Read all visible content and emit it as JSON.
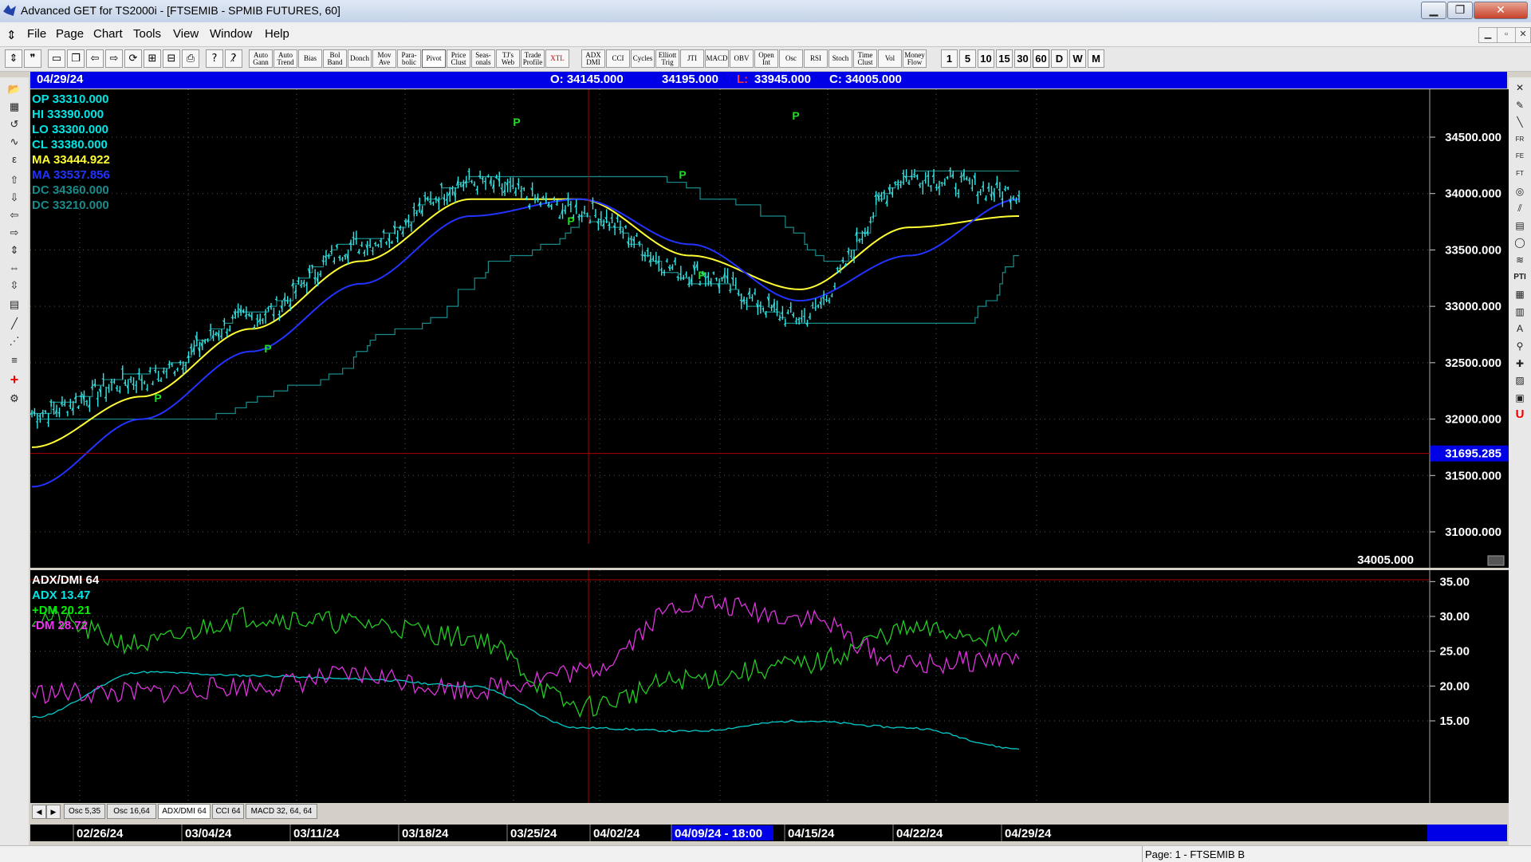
{
  "window": {
    "title": "Advanced GET for TS2000i - [FTSEMIB - SPMIB FUTURES, 60]",
    "buttons": {
      "minimize": "▁",
      "maximize": "❐",
      "close": "✕"
    }
  },
  "menu": {
    "items": [
      "File",
      "Page",
      "Chart",
      "Tools",
      "View",
      "Window",
      "Help"
    ],
    "mdi_buttons": [
      "▁",
      "▫",
      "✕"
    ]
  },
  "toolbar": {
    "icons": [
      "pin-icon",
      "quote-icon",
      "new-page-icon",
      "copy-page-icon",
      "back-icon",
      "forward-icon",
      "refresh-icon",
      "layout-icon",
      "grid-icon",
      "print-icon",
      "help-icon",
      "context-help-icon"
    ],
    "study_buttons": [
      "Auto\nGann",
      "Auto\nTrend",
      "Bias",
      "Bol\nBand",
      "Donch",
      "Mov\nAve",
      "Para-\nbolic",
      "Pivot",
      "Price\nClust",
      "Seas-\nonals",
      "TJ's\nWeb",
      "Trade\nProfile",
      "XTL",
      "ADX\nDMI",
      "CCI",
      "Cycles",
      "Elliott\nTrig",
      "JTI",
      "MACD",
      "OBV",
      "Open\nInt",
      "Osc",
      "RSI",
      "Stoch",
      "Time\nClust",
      "Vol",
      "Money\nFlow"
    ],
    "intervals": [
      "1",
      "5",
      "10",
      "15",
      "30",
      "60",
      "D",
      "W",
      "M"
    ],
    "active_interval": "60"
  },
  "header": {
    "date": "04/29/24",
    "open": "O: 34145.000",
    "high": "34195.000",
    "low_label": "L:",
    "low": "33945.000",
    "close": "C: 34005.000"
  },
  "price_legend": [
    {
      "label": "OP",
      "value": "33310.000",
      "color": "#00e5e5"
    },
    {
      "label": "HI",
      "value": "33390.000",
      "color": "#00e5e5"
    },
    {
      "label": "LO",
      "value": "33300.000",
      "color": "#00e5e5"
    },
    {
      "label": "CL",
      "value": "33380.000",
      "color": "#00e5e5"
    },
    {
      "label": "MA",
      "value": "33444.922",
      "color": "#ffff33"
    },
    {
      "label": "MA",
      "value": "33537.856",
      "color": "#2233ff"
    },
    {
      "label": "DC",
      "value": "34360.000",
      "color": "#1a8a8a"
    },
    {
      "label": "DC",
      "value": "33210.000",
      "color": "#1a8a8a"
    }
  ],
  "price_axis": {
    "ticks": [
      "34500.000",
      "34000.000",
      "33500.000",
      "33000.000",
      "32500.000",
      "32000.000",
      "31500.000",
      "31000.000"
    ],
    "cursor_value": "31695.285",
    "last_value": "34005.000"
  },
  "pivot_label": "P",
  "indicator": {
    "title": "ADX/DMI 64",
    "legend": [
      {
        "label": "ADX",
        "value": "13.47",
        "color": "#00e5e5"
      },
      {
        "label": "+DM",
        "value": "20.21",
        "color": "#00ee00"
      },
      {
        "label": "-DM",
        "value": "28.72",
        "color": "#ee33ee"
      }
    ],
    "ticks": [
      "35.00",
      "30.00",
      "25.00",
      "20.00",
      "15.00"
    ]
  },
  "tabs": [
    "Osc 5,35",
    "Osc 16,64",
    "ADX/DMI 64",
    "CCI 64",
    "MACD 32, 64, 64"
  ],
  "active_tab": "ADX/DMI 64",
  "dates": [
    "02/26/24",
    "03/04/24",
    "03/11/24",
    "03/18/24",
    "03/25/24",
    "04/02/24",
    "04/09/24 - 18:00",
    "04/15/24",
    "04/22/24",
    "04/29/24"
  ],
  "status": {
    "page": "Page: 1 - FTSEMIB B"
  },
  "chart_data": {
    "type": "line",
    "title": "FTSEMIB - SPMIB FUTURES, 60",
    "x": [
      "02/26/24",
      "03/04/24",
      "03/11/24",
      "03/18/24",
      "03/25/24",
      "04/02/24",
      "04/09/24",
      "04/15/24",
      "04/22/24",
      "04/29/24"
    ],
    "series": [
      {
        "name": "CL",
        "values": [
          32050,
          32350,
          32900,
          33550,
          34100,
          33850,
          33300,
          32900,
          34150,
          34005
        ]
      },
      {
        "name": "MA",
        "values": [
          31750,
          32200,
          32800,
          33400,
          33950,
          33950,
          33450,
          33150,
          33700,
          33800
        ]
      },
      {
        "name": "MA",
        "values": [
          31400,
          32000,
          32600,
          33200,
          33800,
          33950,
          33550,
          33050,
          33450,
          33950
        ]
      },
      {
        "name": "ADX",
        "values": [
          15.5,
          22,
          21.5,
          21,
          20,
          14,
          13.5,
          15,
          14,
          11
        ]
      },
      {
        "name": "+DM",
        "values": [
          30,
          26,
          30,
          29,
          27,
          17,
          21,
          23,
          28,
          27
        ]
      },
      {
        "name": "-DM",
        "values": [
          19,
          19,
          20,
          21.5,
          19.5,
          22,
          32,
          30,
          23,
          24
        ]
      }
    ],
    "ylim_price": [
      30600,
      34700
    ],
    "ylim_indicator": [
      11,
      35.5
    ]
  }
}
